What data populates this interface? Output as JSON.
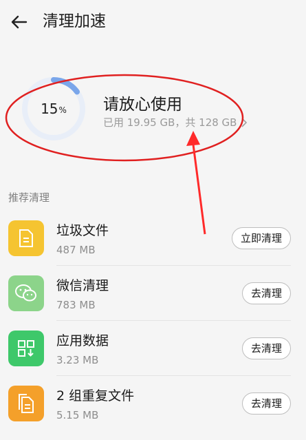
{
  "header": {
    "title": "清理加速",
    "back_icon": "arrow-left-icon"
  },
  "storage": {
    "percent": "15",
    "percent_unit": "%",
    "used_fraction": 0.15,
    "status": "请放心使用",
    "usage_text": "已用 19.95 GB，共 128 GB",
    "ring_color": "#7aa6ea",
    "ring_track_color": "#e8eef8"
  },
  "section_title": "推荐清理",
  "items": [
    {
      "name": "垃圾文件",
      "size": "487 MB",
      "button": "立即清理",
      "icon": "document-icon",
      "color": "#f5c431"
    },
    {
      "name": "微信清理",
      "size": "783 MB",
      "button": "去清理",
      "icon": "wechat-icon",
      "color": "#8cd48a"
    },
    {
      "name": "应用数据",
      "size": "3.23 MB",
      "button": "去清理",
      "icon": "app-data-icon",
      "color": "#3ec86a"
    },
    {
      "name": "2 组重复文件",
      "size": "5.15 MB",
      "button": "去清理",
      "icon": "duplicate-files-icon",
      "color": "#f4a02a"
    }
  ],
  "annotation": {
    "ellipse_color": "#e02020",
    "arrow_color": "#ff2a2a"
  }
}
